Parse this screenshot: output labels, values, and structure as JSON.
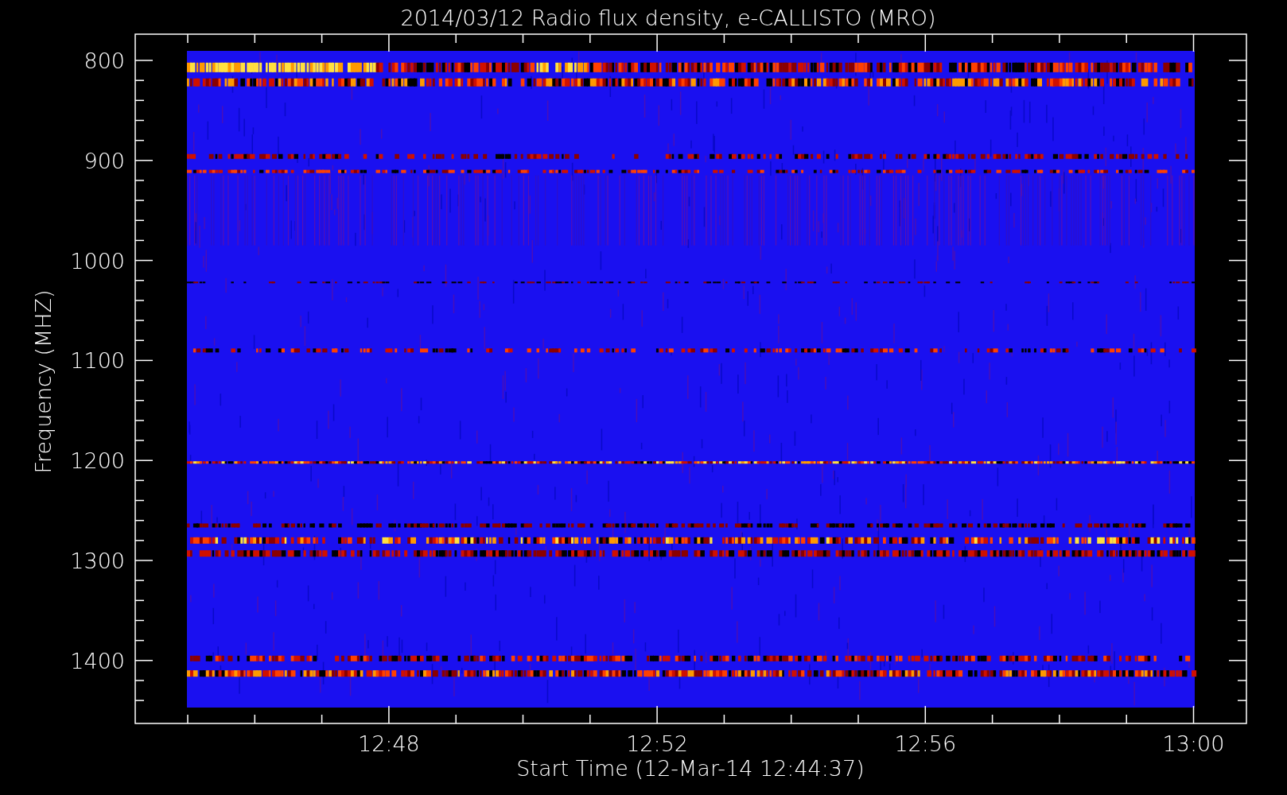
{
  "title": "2014/03/12  Radio flux density, e-CALLISTO (MRO)",
  "x_axis": {
    "label": "Start Time (12-Mar-14 12:44:37)",
    "ticks": [
      "12:48",
      "12:52",
      "12:56",
      "13:00"
    ]
  },
  "y_axis": {
    "label": "Frequency (MHZ)",
    "ticks": [
      "800",
      "900",
      "1000",
      "1100",
      "1200",
      "1300",
      "1400"
    ]
  }
}
